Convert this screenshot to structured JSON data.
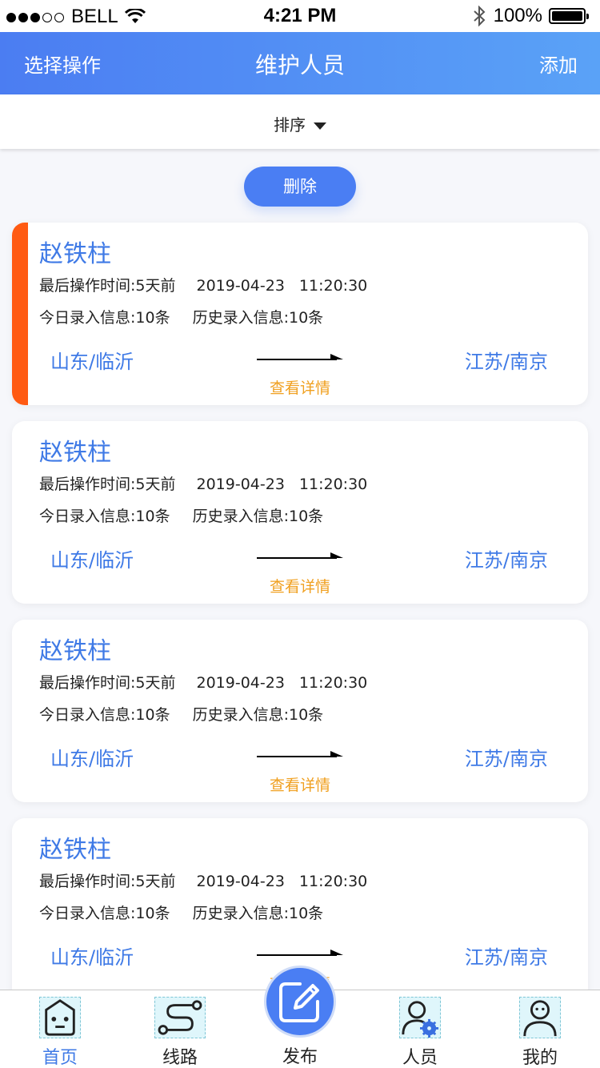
{
  "status_bar": {
    "carrier": "BELL",
    "time": "4:21 PM",
    "battery": "100%"
  },
  "nav": {
    "left": "选择操作",
    "title": "维护人员",
    "right": "添加"
  },
  "sort": {
    "label": "排序"
  },
  "delete_label": "删除",
  "cards": [
    {
      "name": "赵铁柱",
      "last_op_label": "最后操作时间:5天前",
      "date": "2019-04-23",
      "time": "11:20:30",
      "today_label": "今日录入信息:10条",
      "history_label": "历史录入信息:10条",
      "from": "山东/临沂",
      "to": "江苏/南京",
      "detail": "查看详情"
    },
    {
      "name": "赵铁柱",
      "last_op_label": "最后操作时间:5天前",
      "date": "2019-04-23",
      "time": "11:20:30",
      "today_label": "今日录入信息:10条",
      "history_label": "历史录入信息:10条",
      "from": "山东/临沂",
      "to": "江苏/南京",
      "detail": "查看详情"
    },
    {
      "name": "赵铁柱",
      "last_op_label": "最后操作时间:5天前",
      "date": "2019-04-23",
      "time": "11:20:30",
      "today_label": "今日录入信息:10条",
      "history_label": "历史录入信息:10条",
      "from": "山东/临沂",
      "to": "江苏/南京",
      "detail": "查看详情"
    },
    {
      "name": "赵铁柱",
      "last_op_label": "最后操作时间:5天前",
      "date": "2019-04-23",
      "time": "11:20:30",
      "today_label": "今日录入信息:10条",
      "history_label": "历史录入信息:10条",
      "from": "山东/临沂",
      "to": "江苏/南京",
      "detail": "查看详情"
    }
  ],
  "tabs": [
    {
      "label": "首页",
      "icon": "robot-face-icon"
    },
    {
      "label": "线路",
      "icon": "route-icon"
    },
    {
      "label": "发布",
      "icon": "edit-icon"
    },
    {
      "label": "人员",
      "icon": "user-gear-icon"
    },
    {
      "label": "我的",
      "icon": "user-icon"
    }
  ],
  "colors": {
    "primary": "#4a7ef3",
    "accent_orange": "#ff5a12",
    "detail_orange": "#f0a020",
    "link_blue": "#3f7ae6"
  }
}
